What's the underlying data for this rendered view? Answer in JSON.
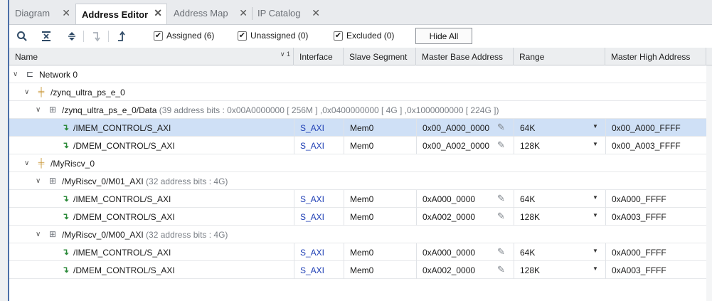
{
  "tabs": [
    {
      "label": "Diagram",
      "active": false
    },
    {
      "label": "Address Editor",
      "active": true
    },
    {
      "label": "Address Map",
      "active": false
    },
    {
      "label": "IP Catalog",
      "active": false
    }
  ],
  "toolbar": {
    "icons": [
      "search-icon",
      "collapse-all-icon",
      "expand-all-icon",
      "move-down-icon",
      "move-up-icon"
    ],
    "assigned": "Assigned (6)",
    "unassigned": "Unassigned (0)",
    "excluded": "Excluded (0)",
    "hide_all": "Hide All"
  },
  "columns": {
    "name": "Name",
    "name_sort": "1",
    "interface": "Interface",
    "slave_segment": "Slave Segment",
    "master_base": "Master Base Address",
    "range": "Range",
    "master_high": "Master High Address"
  },
  "tree": {
    "network": "Network 0",
    "zynq": "/zynq_ultra_ps_e_0",
    "zynq_data": "/zynq_ultra_ps_e_0/Data",
    "zynq_data_info": "(39 address bits : 0x00A0000000 [ 256M ] ,0x0400000000 [ 4G ] ,0x1000000000 [ 224G ])",
    "riscv": "/MyRiscv_0",
    "m01": "/MyRiscv_0/M01_AXI",
    "m01_info": "(32 address bits : 4G)",
    "m00": "/MyRiscv_0/M00_AXI",
    "m00_info": "(32 address bits : 4G)"
  },
  "rows": [
    {
      "name": "/IMEM_CONTROL/S_AXI",
      "interface": "S_AXI",
      "segment": "Mem0",
      "base": "0x00_A000_0000",
      "range": "64K",
      "high": "0x00_A000_FFFF"
    },
    {
      "name": "/DMEM_CONTROL/S_AXI",
      "interface": "S_AXI",
      "segment": "Mem0",
      "base": "0x00_A002_0000",
      "range": "128K",
      "high": "0x00_A003_FFFF"
    },
    {
      "name": "/IMEM_CONTROL/S_AXI",
      "interface": "S_AXI",
      "segment": "Mem0",
      "base": "0xA000_0000",
      "range": "64K",
      "high": "0xA000_FFFF"
    },
    {
      "name": "/DMEM_CONTROL/S_AXI",
      "interface": "S_AXI",
      "segment": "Mem0",
      "base": "0xA002_0000",
      "range": "128K",
      "high": "0xA003_FFFF"
    },
    {
      "name": "/IMEM_CONTROL/S_AXI",
      "interface": "S_AXI",
      "segment": "Mem0",
      "base": "0xA000_0000",
      "range": "64K",
      "high": "0xA000_FFFF"
    },
    {
      "name": "/DMEM_CONTROL/S_AXI",
      "interface": "S_AXI",
      "segment": "Mem0",
      "base": "0xA002_0000",
      "range": "128K",
      "high": "0xA003_FFFF"
    }
  ],
  "colors": {
    "selected_row": "#cfe0f6",
    "link": "#1f3fb5",
    "accent": "#4b6fa8"
  }
}
